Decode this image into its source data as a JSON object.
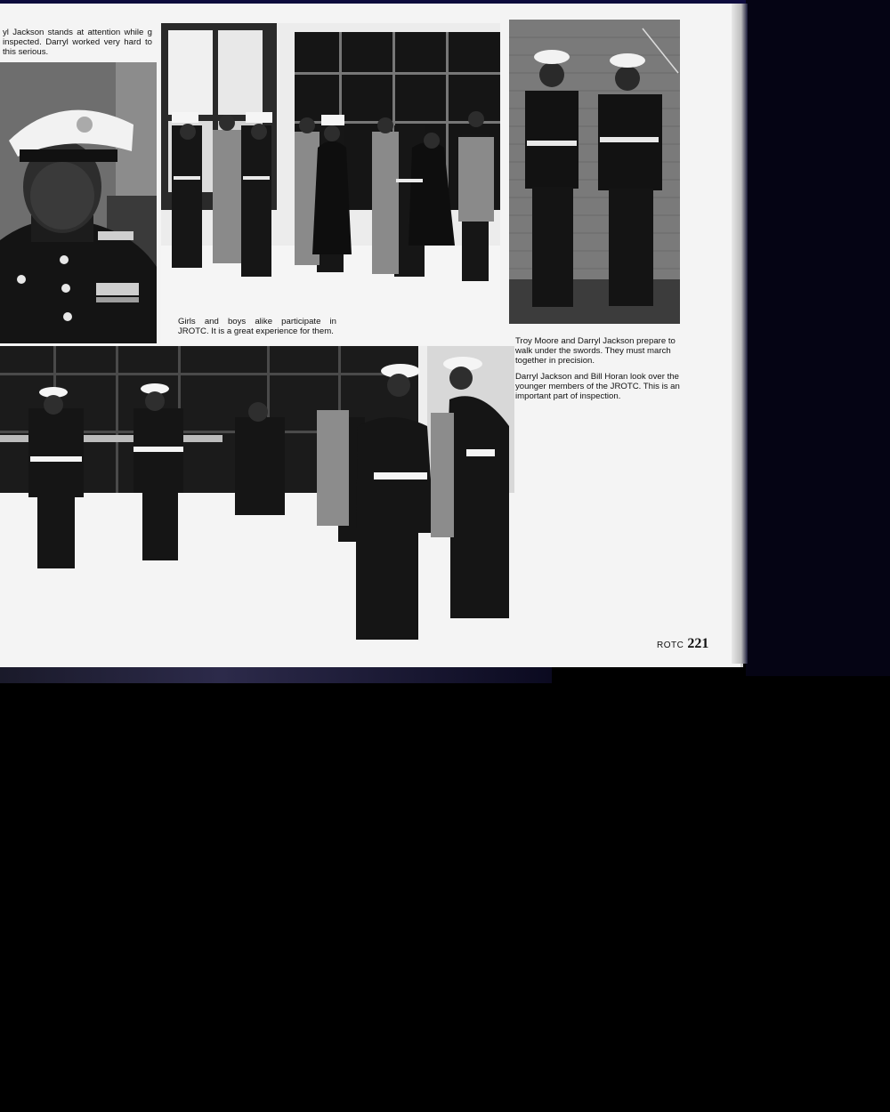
{
  "captions": {
    "portrait": "yl Jackson stands at attention while g inspected. Darryl worked very hard to this serious.",
    "girls_boys": "Girls and boys alike participate in JROTC. It is a great experience for them.",
    "troy_darryl": "Troy Moore and Darryl Jackson prepare to walk under the swords. They must march together in precision.",
    "darryl_bill": "Darryl Jackson and Bill Horan look over the younger members of the JROTC. This is an important part of inspection."
  },
  "folio": {
    "section": "ROTC",
    "page_number": "221"
  },
  "photos": {
    "portrait": "photo of cadet in dress uniform and white cap",
    "line": "photo of cadets standing in a line",
    "pair": "photo of two cadets in dress uniform by brick wall",
    "inspection": "photo of cadets being inspected in hallway"
  }
}
